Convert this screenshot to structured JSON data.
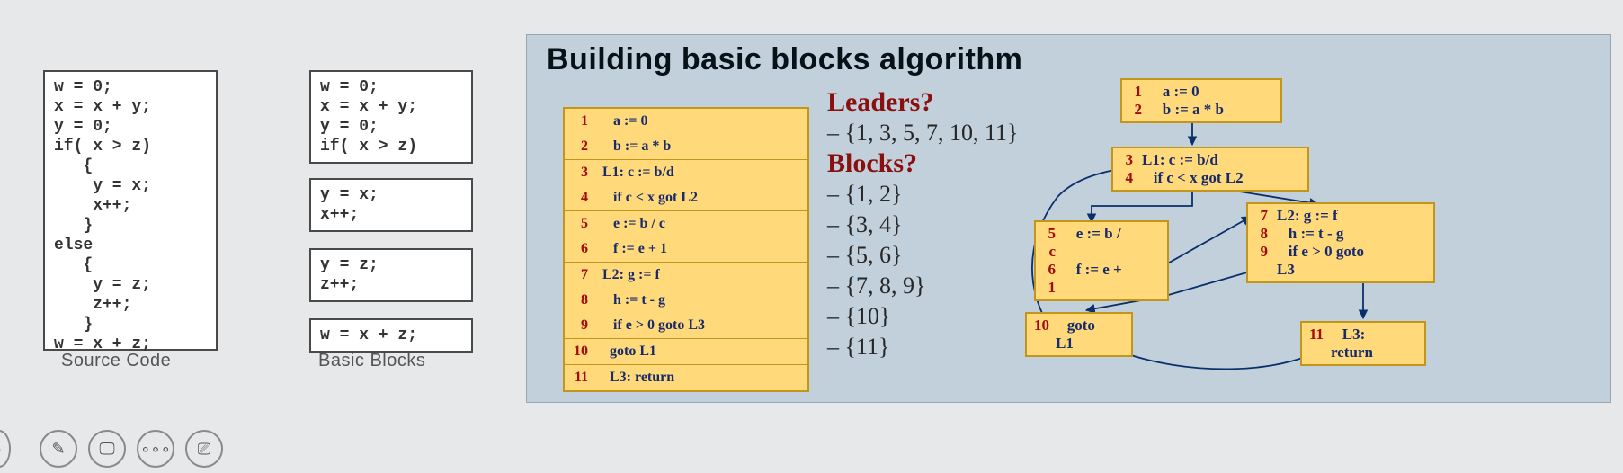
{
  "left": {
    "source_code": "w = 0;\nx = x + y;\ny = 0;\nif( x > z)\n   {\n    y = x;\n    x++;\n   }\nelse\n   {\n    y = z;\n    z++;\n   }\nw = x + z;",
    "source_caption": "Source Code",
    "blocks": [
      "w = 0;\nx = x + y;\ny = 0;\nif( x > z)",
      "y = x;\nx++;",
      "y = z;\nz++;",
      "w = x + z;"
    ],
    "blocks_caption": "Basic Blocks"
  },
  "slide": {
    "title": "Building basic blocks algorithm",
    "tac": [
      [
        {
          "n": "1",
          "c": "   a := 0"
        },
        {
          "n": "2",
          "c": "   b := a * b"
        }
      ],
      [
        {
          "n": "3",
          "c": "L1: c := b/d"
        },
        {
          "n": "4",
          "c": "   if c < x got L2"
        }
      ],
      [
        {
          "n": "5",
          "c": "   e := b / c"
        },
        {
          "n": "6",
          "c": "   f := e + 1"
        }
      ],
      [
        {
          "n": "7",
          "c": "L2: g := f"
        },
        {
          "n": "8",
          "c": "   h := t - g"
        },
        {
          "n": "9",
          "c": "   if e > 0 goto L3"
        }
      ],
      [
        {
          "n": "10",
          "c": "  goto L1"
        }
      ],
      [
        {
          "n": "11",
          "c": "  L3: return"
        }
      ]
    ],
    "qa": {
      "q1": "Leaders?",
      "a1": "– {1, 3, 5, 7, 10, 11}",
      "q2": "Blocks?",
      "a2": "– {1, 2}",
      "a3": "– {3, 4}",
      "a4": "– {5, 6}",
      "a5": "– {7, 8, 9}",
      "a6": "– {10}",
      "a7": "– {11}"
    },
    "cfg": {
      "n1": [
        {
          "n": "1",
          "c": "   a := 0"
        },
        {
          "n": "2",
          "c": "   b := a * b"
        }
      ],
      "n2": [
        {
          "n": "3",
          "c": "L1: c := b/d"
        },
        {
          "n": "4",
          "c": "   if c < x got L2"
        }
      ],
      "n3": [
        {
          "n": "5",
          "c": "   e := b /"
        },
        {
          "n": "c",
          "c": ""
        },
        {
          "n": "6",
          "c": "   f := e +"
        },
        {
          "n": "1",
          "c": ""
        }
      ],
      "n4": [
        {
          "n": "7",
          "c": "L2: g := f"
        },
        {
          "n": "8",
          "c": "   h := t - g"
        },
        {
          "n": "9",
          "c": "   if e > 0 goto"
        },
        {
          "n": "",
          "c": "L3"
        }
      ],
      "n5": [
        {
          "n": "10",
          "c": "   goto"
        },
        {
          "n": "",
          "c": "L1"
        }
      ],
      "n6": [
        {
          "n": "11",
          "c": "   L3:"
        },
        {
          "n": "",
          "c": "return"
        }
      ]
    }
  },
  "toolbar": {
    "pen": "✎",
    "monitor": "🖵",
    "more": "∘∘∘",
    "noscreen": "⎚"
  }
}
